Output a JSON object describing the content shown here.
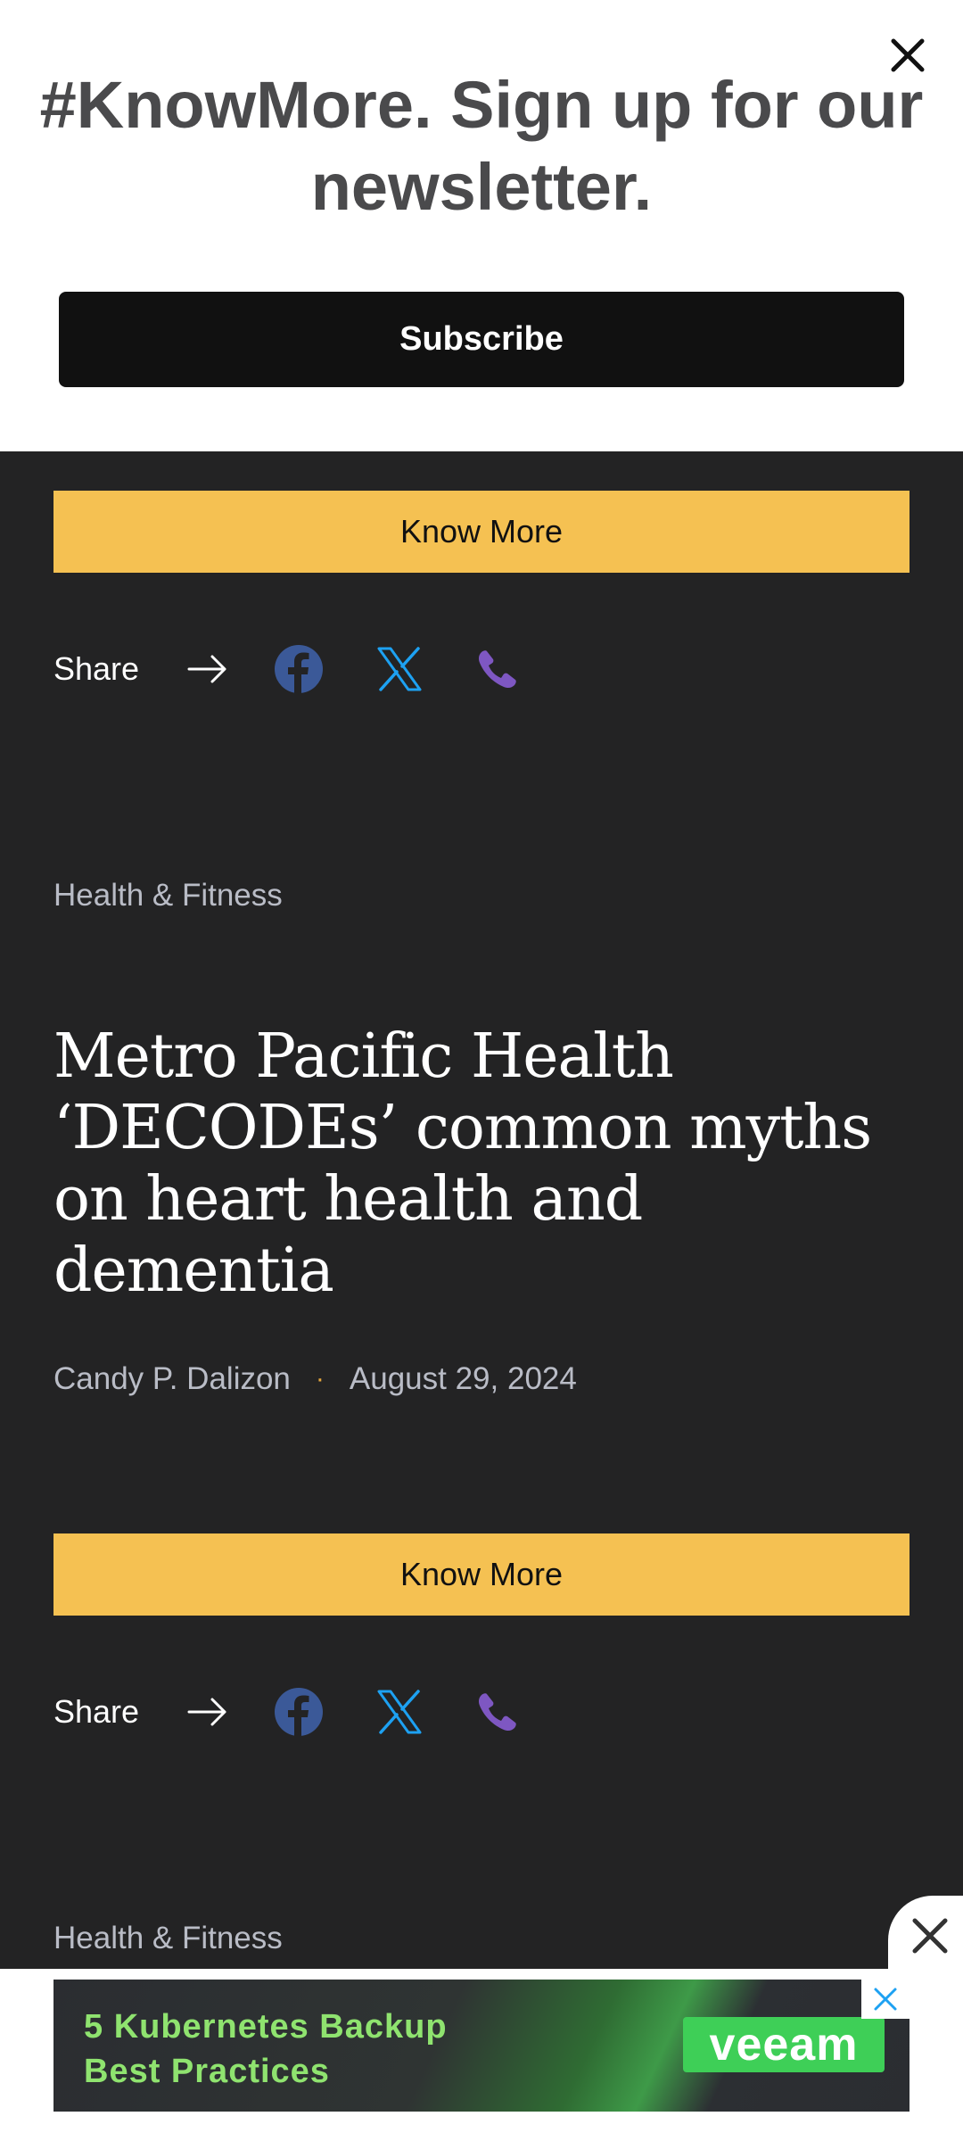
{
  "newsletter": {
    "title": "#KnowMore. Sign up for our newsletter.",
    "subscribe_label": "Subscribe"
  },
  "share": {
    "label": "Share"
  },
  "know_more_label": "Know More",
  "article": {
    "category": "Health & Fitness",
    "title": "Metro Pacific Health ‘DECODEs’ common myths on heart health and dementia",
    "author": "Candy P. Dalizon",
    "separator": "·",
    "date": "August 29, 2024"
  },
  "next_article": {
    "category": "Health & Fitness"
  },
  "ad": {
    "line1": "5 Kubernetes Backup",
    "line2": "Best Practices",
    "brand": "veeam"
  },
  "colors": {
    "background": "#232324",
    "accent": "#f5c152",
    "facebook": "#3b5998",
    "x_blue": "#1da1f2",
    "phone_purple": "#7e57c2"
  }
}
